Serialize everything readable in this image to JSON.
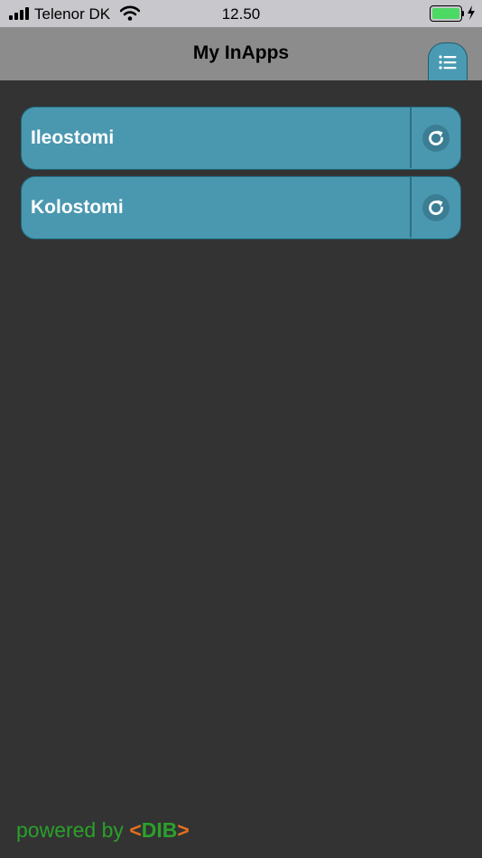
{
  "status_bar": {
    "carrier": "Telenor DK",
    "time": "12.50",
    "battery_level": 1.0
  },
  "header": {
    "title": "My InApps",
    "menu_icon": "list-icon"
  },
  "apps": [
    {
      "label": "Ileostomi",
      "action_icon": "refresh-icon"
    },
    {
      "label": "Kolostomi",
      "action_icon": "refresh-icon"
    }
  ],
  "footer": {
    "powered_by": "powered by",
    "bracket_open": "<",
    "brand": "DIB",
    "bracket_close": ">"
  },
  "colors": {
    "background": "#333333",
    "header": "#8c8c8c",
    "item": "#4a98b0",
    "footer_green": "#2aa12a",
    "footer_orange": "#e2701f"
  }
}
